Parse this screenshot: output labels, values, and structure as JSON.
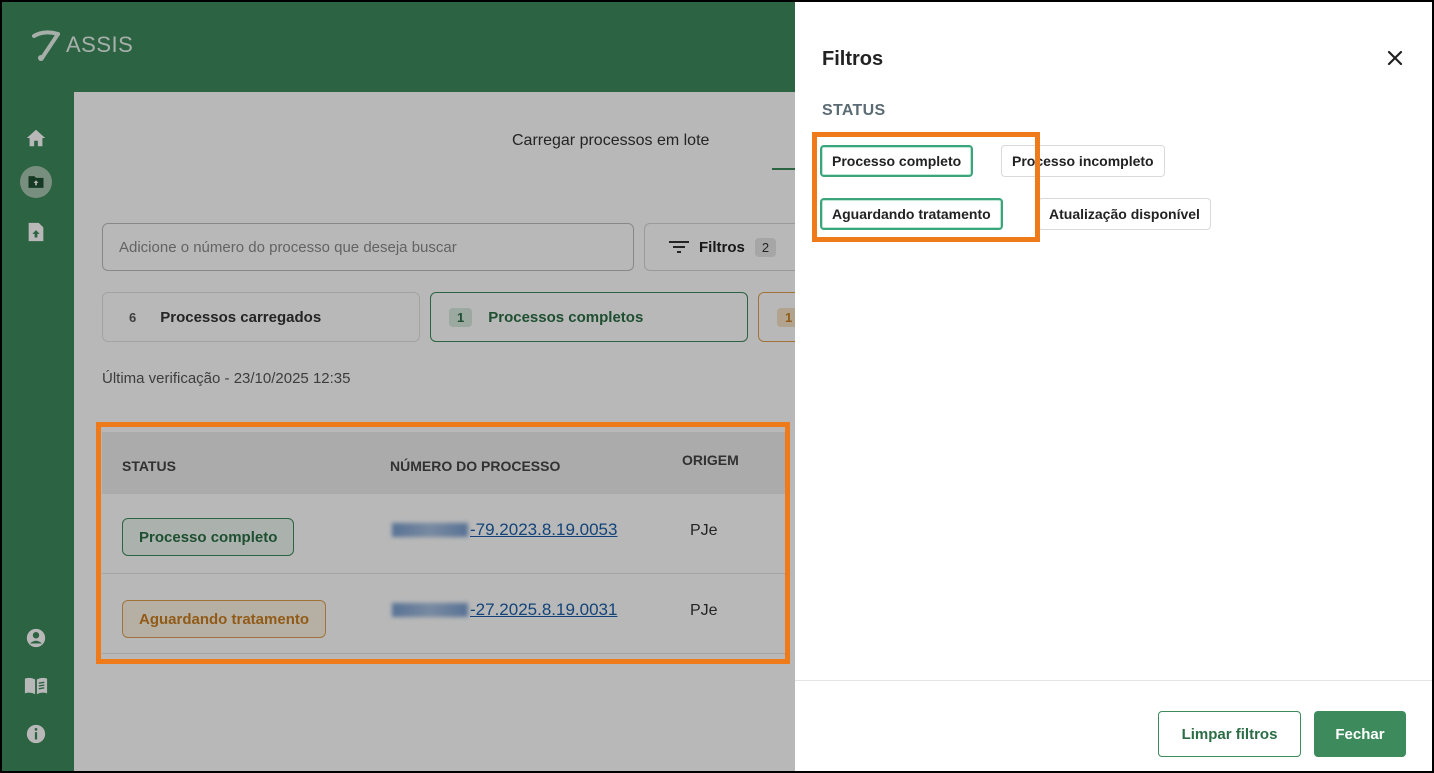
{
  "app": {
    "logo_text": "ASSIS"
  },
  "colors": {
    "brand_green": "#3d8a5c",
    "highlight_orange": "#ee7a1a",
    "success": "#2b6e45",
    "warning": "#c97f20"
  },
  "sidebar": {
    "items": [
      {
        "icon": "home-icon"
      },
      {
        "icon": "folder-upload-icon"
      },
      {
        "icon": "file-upload-icon"
      },
      {
        "icon": "user-icon"
      },
      {
        "icon": "book-icon"
      },
      {
        "icon": "info-icon"
      }
    ]
  },
  "main": {
    "tab_label": "Carregar processos em lote",
    "search": {
      "placeholder": "Adicione o número do processo que deseja buscar"
    },
    "filters_button": {
      "label": "Filtros",
      "count": "2"
    },
    "summary": [
      {
        "count": "6",
        "label": "Processos carregados"
      },
      {
        "count": "1",
        "label": "Processos completos"
      },
      {
        "count": "1",
        "label": ""
      }
    ],
    "last_check": "Última verificação - 23/10/2025 12:35",
    "table": {
      "headers": {
        "status": "STATUS",
        "number": "NÚMERO DO PROCESSO",
        "origin": "ORIGEM"
      },
      "rows": [
        {
          "status": "Processo completo",
          "number": "-79.2023.8.19.0053",
          "origin": "PJe"
        },
        {
          "status": "Aguardando tratamento",
          "number": "-27.2025.8.19.0031",
          "origin": "PJe"
        }
      ]
    }
  },
  "drawer": {
    "title": "Filtros",
    "section": "STATUS",
    "chips": [
      {
        "label": "Processo completo",
        "selected": true
      },
      {
        "label": "Processo incompleto",
        "selected": false
      },
      {
        "label": "Aguardando tratamento",
        "selected": true
      },
      {
        "label": "Atualização disponível",
        "selected": false
      }
    ],
    "clear_label": "Limpar filtros",
    "close_label": "Fechar"
  }
}
